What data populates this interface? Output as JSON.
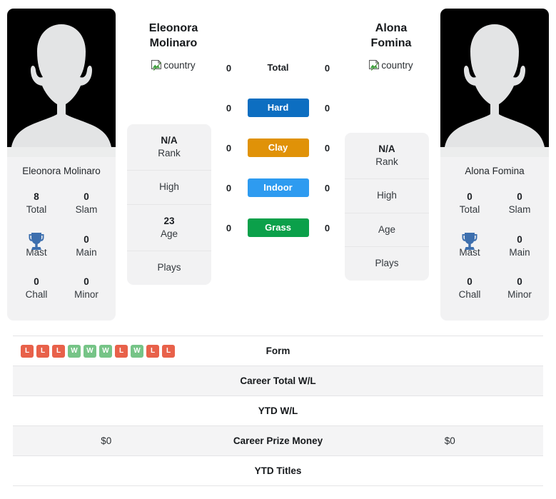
{
  "players": {
    "left": {
      "name": "Eleonora Molinaro",
      "display_name_line1": "Eleonora",
      "display_name_line2": "Molinaro",
      "country_alt": "country",
      "avatar_name": "player-photo-placeholder",
      "stats": [
        {
          "value": "8",
          "label": "Total"
        },
        {
          "value": "0",
          "label": "Slam"
        },
        {
          "value": "0",
          "label": "Mast"
        },
        {
          "value": "0",
          "label": "Main"
        },
        {
          "value": "0",
          "label": "Chall"
        },
        {
          "value": "0",
          "label": "Minor"
        }
      ],
      "info": [
        {
          "value": "N/A",
          "label": "Rank"
        },
        {
          "value": "",
          "label": "High"
        },
        {
          "value": "23",
          "label": "Age"
        },
        {
          "value": "",
          "label": "Plays"
        }
      ]
    },
    "right": {
      "name": "Alona Fomina",
      "display_name_line1": "Alona",
      "display_name_line2": "Fomina",
      "country_alt": "country",
      "avatar_name": "player-photo-placeholder",
      "stats": [
        {
          "value": "0",
          "label": "Total"
        },
        {
          "value": "0",
          "label": "Slam"
        },
        {
          "value": "0",
          "label": "Mast"
        },
        {
          "value": "0",
          "label": "Main"
        },
        {
          "value": "0",
          "label": "Chall"
        },
        {
          "value": "0",
          "label": "Minor"
        }
      ],
      "info": [
        {
          "value": "N/A",
          "label": "Rank"
        },
        {
          "value": "",
          "label": "High"
        },
        {
          "value": "",
          "label": "Age"
        },
        {
          "value": "",
          "label": "Plays"
        }
      ]
    }
  },
  "surfaces": [
    {
      "label": "Total",
      "left": "0",
      "right": "0",
      "color": "",
      "pill": false
    },
    {
      "label": "Hard",
      "left": "0",
      "right": "0",
      "color": "#0d6ec1",
      "pill": true
    },
    {
      "label": "Clay",
      "left": "0",
      "right": "0",
      "color": "#e09208",
      "pill": true
    },
    {
      "label": "Indoor",
      "left": "0",
      "right": "0",
      "color": "#2e9bf0",
      "pill": true
    },
    {
      "label": "Grass",
      "left": "0",
      "right": "0",
      "color": "#0ba04a",
      "pill": true
    }
  ],
  "table_rows": [
    {
      "label": "Form",
      "left": "",
      "right": "",
      "form_left": [
        "L",
        "L",
        "L",
        "W",
        "W",
        "W",
        "L",
        "W",
        "L",
        "L"
      ],
      "form_right": []
    },
    {
      "label": "Career Total W/L",
      "left": "",
      "right": ""
    },
    {
      "label": "YTD W/L",
      "left": "",
      "right": ""
    },
    {
      "label": "Career Prize Money",
      "left": "$0",
      "right": "$0"
    },
    {
      "label": "YTD Titles",
      "left": "",
      "right": ""
    }
  ],
  "colors": {
    "hard": "#0d6ec1",
    "clay": "#e09208",
    "indoor": "#2e9bf0",
    "grass": "#0ba04a",
    "win_badge": "#76c487",
    "loss_badge": "#e8614a",
    "trophy": "#3d6fae",
    "card_bg": "#f2f2f3"
  }
}
